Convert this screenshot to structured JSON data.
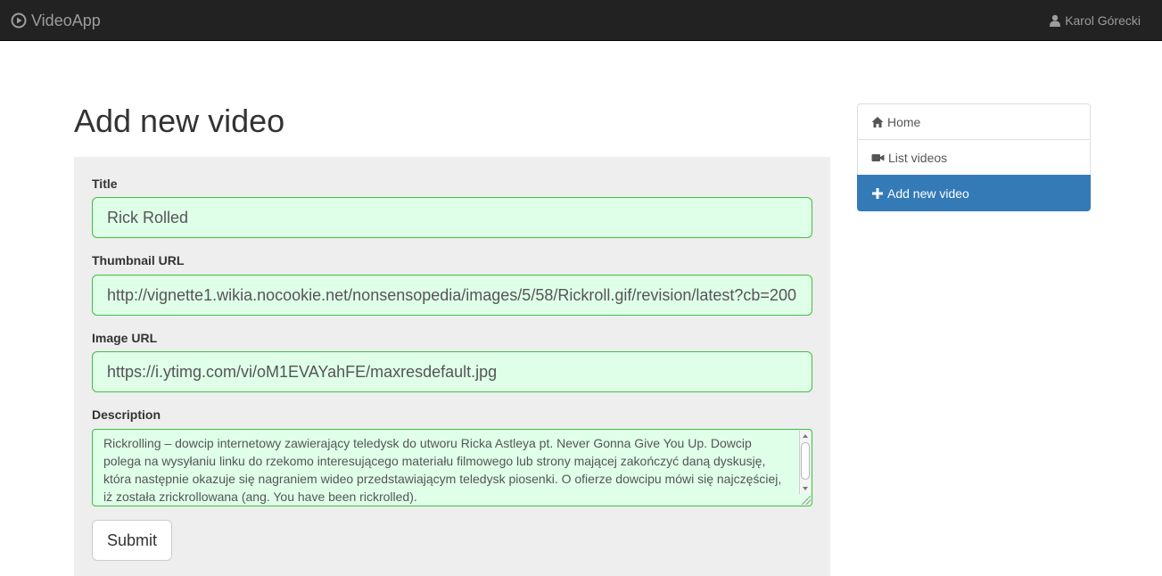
{
  "navbar": {
    "brand": "VideoApp",
    "brand_icon": "play-circle-icon",
    "user_name": "Karol Górecki",
    "user_icon": "user-icon"
  },
  "page": {
    "title": "Add new video"
  },
  "form": {
    "title_label": "Title",
    "title_value": "Rick Rolled",
    "thumbnail_label": "Thumbnail URL",
    "thumbnail_value": "http://vignette1.wikia.nocookie.net/nonsensopedia/images/5/58/Rickroll.gif/revision/latest?cb=200",
    "image_label": "Image URL",
    "image_value": "https://i.ytimg.com/vi/oM1EVAYahFE/maxresdefault.jpg",
    "description_label": "Description",
    "description_value": "Rickrolling – dowcip internetowy zawierający teledysk do utworu Ricka Astleya pt. Never Gonna Give You Up. Dowcip polega na wysyłaniu linku do rzekomo interesującego materiału filmowego lub strony mającej zakończyć daną dyskusję, która następnie okazuje się nagraniem wideo przedstawiającym teledysk piosenki. O ofierze dowcipu mówi się najczęściej, iż została zrickrollowana (ang. You have been rickrolled).",
    "submit_label": "Submit",
    "valid_bg_color": "#dfffe9",
    "valid_border_color": "#3fbf3f"
  },
  "sidebar": {
    "items": [
      {
        "label": "Home",
        "icon": "home-icon",
        "active": false
      },
      {
        "label": "List videos",
        "icon": "video-camera-icon",
        "active": false
      },
      {
        "label": "Add new video",
        "icon": "plus-icon",
        "active": true
      }
    ],
    "active_color": "#337ab7"
  }
}
